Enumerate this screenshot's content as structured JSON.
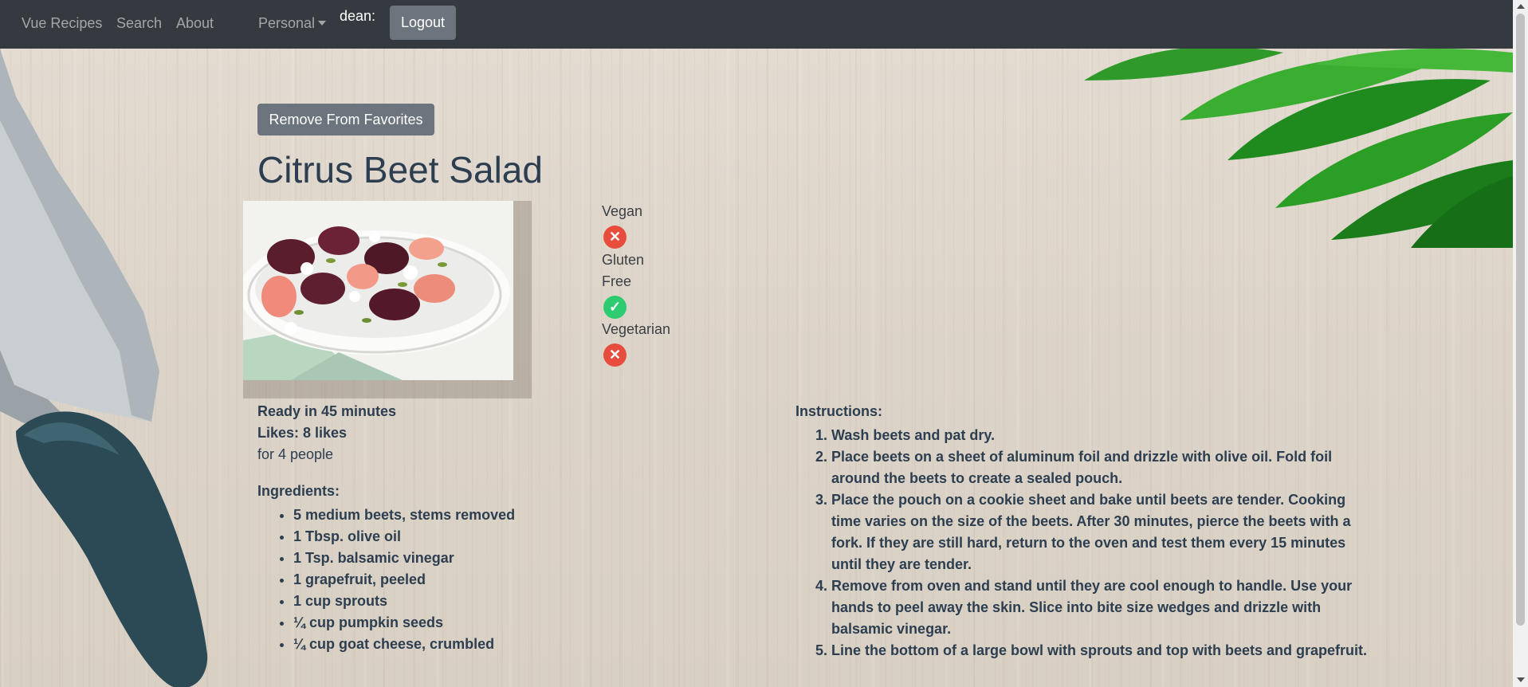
{
  "nav": {
    "brand": "Vue Recipes",
    "search": "Search",
    "about": "About",
    "personal": "Personal",
    "user": "dean:",
    "logout": "Logout"
  },
  "recipe": {
    "favorite_button": "Remove From Favorites",
    "title": "Citrus Beet Salad",
    "diets": [
      {
        "label": "Vegan",
        "status": "no",
        "icon": "x-circle-icon"
      },
      {
        "label": "Gluten Free",
        "status": "yes",
        "icon": "check-circle-icon"
      },
      {
        "label": "Vegetarian",
        "status": "no",
        "icon": "x-circle-icon"
      }
    ],
    "ready": "Ready in 45 minutes",
    "likes": "Likes: 8 likes",
    "servings": "for 4 people",
    "ingredients_heading": "Ingredients:",
    "ingredients": [
      "5 medium beets, stems removed",
      "1 Tbsp. olive oil",
      "1 Tsp. balsamic vinegar",
      "1 grapefruit, peeled",
      "1 cup sprouts",
      "¼ cup pumpkin seeds",
      "¼ cup goat cheese, crumbled"
    ],
    "instructions_heading": "Instructions:",
    "instructions": [
      "Wash beets and pat dry.",
      "Place beets on a sheet of aluminum foil and drizzle with olive oil. Fold foil around the beets to create a sealed pouch.",
      "Place the pouch on a cookie sheet and bake until beets are tender. Cooking time varies on the size of the beets. After 30 minutes, pierce the beets with a fork. If they are still hard, return to the oven and test them every 15 minutes until they are tender.",
      "Remove from oven and stand until they are cool enough to handle. Use your hands to peel away the skin. Slice into bite size wedges and drizzle with balsamic vinegar.",
      "Line the bottom of a large bowl with sprouts and top with beets and grapefruit."
    ]
  },
  "colors": {
    "navbar": "#343a40",
    "button": "#6c757d",
    "text": "#2c3e50",
    "no": "#e74c3c",
    "yes": "#2ecc71"
  }
}
